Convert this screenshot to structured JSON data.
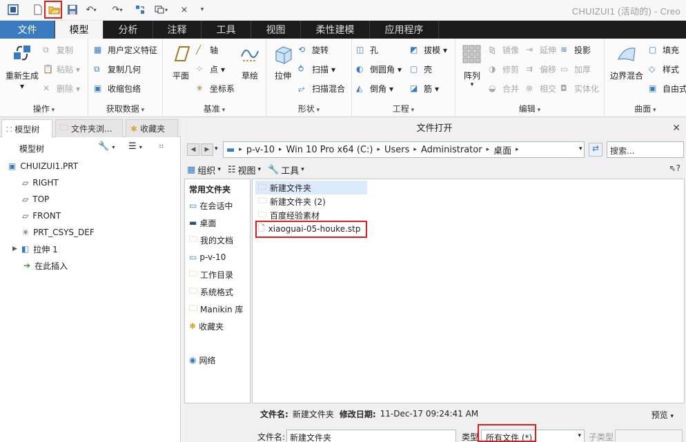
{
  "app": {
    "title": "CHUIZUI1 (活动的) - Creo"
  },
  "tabs": [
    "文件",
    "模型",
    "分析",
    "注释",
    "工具",
    "视图",
    "柔性建模",
    "应用程序"
  ],
  "ribbon": {
    "operations": {
      "label": "操作",
      "regenerate": "重新生成",
      "copy": "复制",
      "paste": "粘贴",
      "delete": "删除"
    },
    "get_data": {
      "label": "获取数据",
      "udf": "用户定义特征",
      "copy_geom": "复制几何",
      "shrinkwrap": "收缩包络"
    },
    "datum": {
      "label": "基准",
      "plane": "平面",
      "axis": "轴",
      "point": "点",
      "csys": "坐标系",
      "sketch": "草绘"
    },
    "shapes": {
      "label": "形状",
      "extrude": "拉伸",
      "revolve": "旋转",
      "sweep": "扫描",
      "swept_blend": "扫描混合"
    },
    "engineering": {
      "label": "工程",
      "hole": "孔",
      "round": "倒圆角",
      "chamfer": "倒角",
      "draft": "拔模",
      "shell": "壳",
      "rib": "筋"
    },
    "editing": {
      "label": "编辑",
      "array": "阵列",
      "mirror": "镜像",
      "extend": "延伸",
      "project": "投影",
      "trim": "修剪",
      "offset": "偏移",
      "thicken": "加厚",
      "merge": "合并",
      "intersect": "相交",
      "solidify": "实体化"
    },
    "surfaces": {
      "label": "曲面",
      "boundary_blend": "边界混合",
      "fill": "填充",
      "style": "样式",
      "freestyle": "自由式"
    }
  },
  "left_panel": {
    "tabs": [
      "模型树",
      "文件夹浏...",
      "收藏夹"
    ],
    "title": "模型树",
    "tree": [
      "CHUIZUI1.PRT",
      "RIGHT",
      "TOP",
      "FRONT",
      "PRT_CSYS_DEF",
      "拉伸 1",
      "在此插入"
    ]
  },
  "dialog": {
    "title": "文件打开",
    "path": [
      "p-v-10",
      "Win 10 Pro x64 (C:)",
      "Users",
      "Administrator",
      "桌面"
    ],
    "search_placeholder": "搜索...",
    "toolbar": {
      "organize": "组织",
      "views": "视图",
      "tools": "工具"
    },
    "places_header": "常用文件夹",
    "places": [
      "在会话中",
      "桌面",
      "我的文档",
      "p-v-10",
      "工作目录",
      "系统格式",
      "Manikin 库",
      "收藏夹",
      "网络"
    ],
    "files": [
      {
        "name": "新建文件夹",
        "kind": "folder"
      },
      {
        "name": "新建文件夹 (2)",
        "kind": "folder"
      },
      {
        "name": "百度经验素材",
        "kind": "folder"
      },
      {
        "name": "xiaoguai-05-houke.stp",
        "kind": "file"
      }
    ],
    "info": {
      "name_label": "文件名:",
      "name_value": "新建文件夹",
      "date_label": "修改日期:",
      "date_value": "11-Dec-17 09:24:41 AM"
    },
    "preview": "预览",
    "filename_label": "文件名:",
    "filename_value": "新建文件夹",
    "type_label": "类型",
    "type_value": "所有文件 (*)",
    "subtype_label": "子类型"
  },
  "colors": {
    "accent": "#3a7bbf",
    "highlight": "#e11b1b",
    "selection": "#dcebfb"
  }
}
